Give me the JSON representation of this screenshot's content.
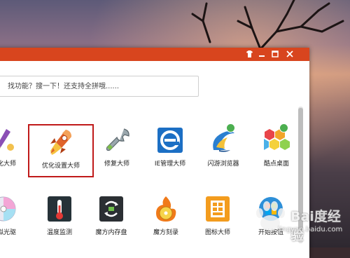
{
  "search": {
    "placeholder": "找功能？搜一下！还支持全拼哦......"
  },
  "window_controls": {
    "skin": "skin-icon",
    "minimize": "minimize-icon",
    "maximize": "maximize-icon",
    "close": "close-icon"
  },
  "tools_row1": [
    {
      "label": "美化大师",
      "icon": "paintbrush-icon"
    },
    {
      "label": "优化设置大师",
      "icon": "rocket-icon",
      "selected": true
    },
    {
      "label": "修复大师",
      "icon": "wrench-icon"
    },
    {
      "label": "IE管理大师",
      "icon": "ie-icon"
    },
    {
      "label": "闪游浏览器",
      "icon": "browser-icon",
      "badge": true
    },
    {
      "label": "酷点桌面",
      "icon": "hexagons-icon",
      "badge": true
    }
  ],
  "tools_row2": [
    {
      "label": "虚拟光驱",
      "icon": "disc-icon"
    },
    {
      "label": "温度监测",
      "icon": "thermometer-icon"
    },
    {
      "label": "魔方内存盘",
      "icon": "memory-disk-icon"
    },
    {
      "label": "魔方刻录",
      "icon": "burn-disc-icon"
    },
    {
      "label": "图标大师",
      "icon": "icon-master-icon"
    },
    {
      "label": "开始按钮",
      "icon": "start-button-icon"
    }
  ],
  "watermark": {
    "text": "Bai度经验",
    "sub": "jingyan.baidu.com"
  },
  "colors": {
    "titlebar": "#d8451e",
    "selection_border": "#c01a1a"
  }
}
